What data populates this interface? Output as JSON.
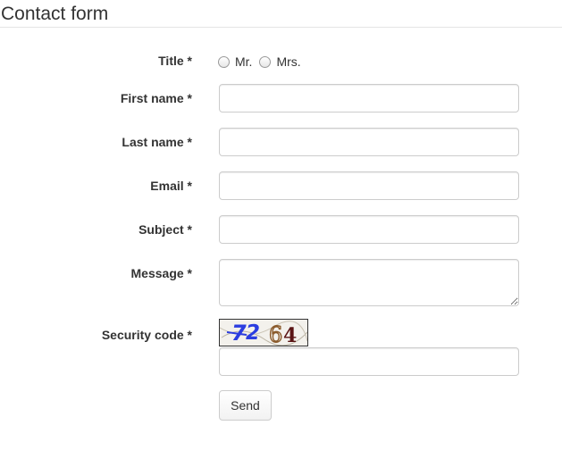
{
  "header": {
    "title": "Contact form"
  },
  "form": {
    "title_label": "Title *",
    "title_options": [
      {
        "label": "Mr.",
        "selected": false
      },
      {
        "label": "Mrs.",
        "selected": false
      }
    ],
    "first_name_label": "First name *",
    "first_name_value": "",
    "last_name_label": "Last name *",
    "last_name_value": "",
    "email_label": "Email *",
    "email_value": "",
    "subject_label": "Subject *",
    "subject_value": "",
    "message_label": "Message *",
    "message_value": "",
    "security_code_label": "Security code *",
    "captcha_text": "7264",
    "security_code_value": "",
    "send_label": "Send"
  },
  "colors": {
    "text": "#333333",
    "input_border": "#cccccc",
    "rule": "#e5e5e5",
    "captcha_blue": "#2b3de0",
    "captcha_brown": "#8a5a2b",
    "captcha_dark_red": "#5a1414"
  }
}
